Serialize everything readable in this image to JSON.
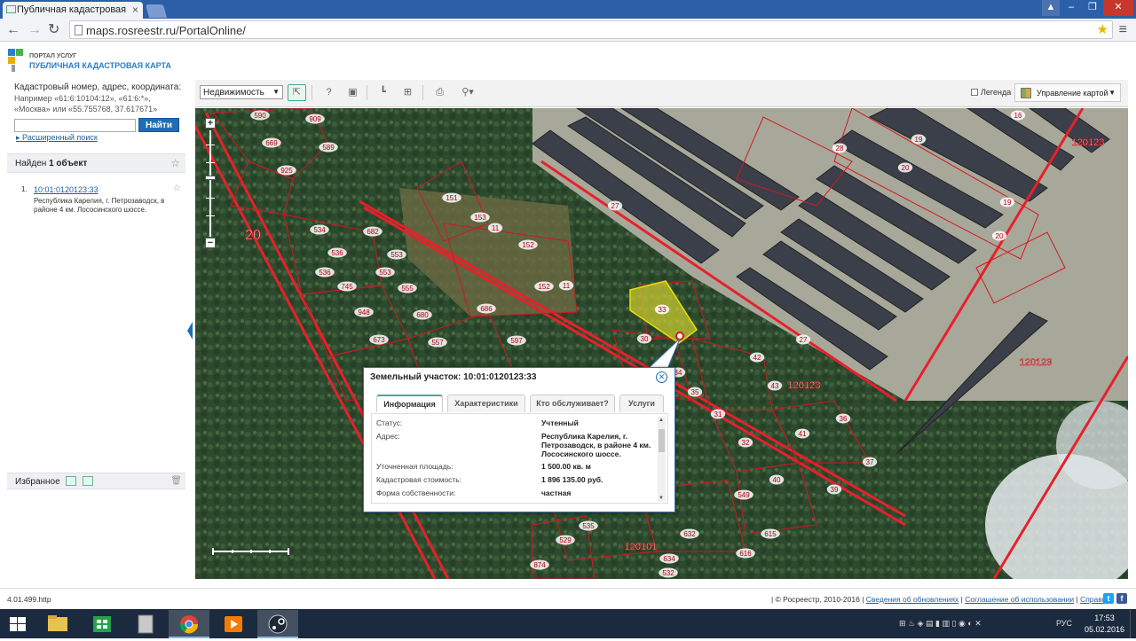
{
  "browser": {
    "tab_title": "Публичная кадастровая",
    "url": "maps.rosreestr.ru/PortalOnline/"
  },
  "portal": {
    "brand_small": "ПОРТАЛ УСЛУГ",
    "brand_title": "ПУБЛИЧНАЯ КАДАСТРОВАЯ КАРТА"
  },
  "search": {
    "help_title": "Кадастровый номер, адрес, координата:",
    "help_example": "Например «61:6:10104:12», «61:6:*», «Москва» или «55.755768, 37.617671»",
    "input_value": "",
    "button": "Найти",
    "advanced": "Расширенный поиск"
  },
  "results": {
    "found_prefix": "Найден ",
    "found_count": "1 объект",
    "item_number": "1.",
    "item_id": "10:01:0120123:33",
    "item_address": "Республика Карелия, г. Петрозаводск, в районе 4 км. Лососинского шоссе."
  },
  "favorites": {
    "label": "Избранное"
  },
  "toolbar": {
    "layer_select": "Недвижимость",
    "legend": "Легенда",
    "map_manage": "Управление картой"
  },
  "map": {
    "labels": [
      "590",
      "909",
      "669",
      "589",
      "925",
      "534",
      "682",
      "536",
      "553",
      "536",
      "553",
      "745",
      "555",
      "948",
      "680",
      "686",
      "673",
      "557",
      "597",
      "151",
      "153",
      "11",
      "152",
      "152",
      "11",
      "33",
      "30",
      "27",
      "16",
      "19",
      "20",
      "19",
      "20",
      "28",
      "120123",
      "120123",
      "120123",
      "27",
      "42",
      "43",
      "34",
      "35",
      "31",
      "32",
      "36",
      "41",
      "37",
      "40",
      "39",
      "549",
      "615",
      "616",
      "632",
      "634",
      "532",
      "535",
      "529",
      "874",
      "120101",
      "20"
    ]
  },
  "popup": {
    "title": "Земельный участок: 10:01:0120123:33",
    "tabs": [
      "Информация",
      "Характеристики",
      "Кто обслуживает?",
      "Услуги"
    ],
    "rows": [
      {
        "label": "Статус:",
        "value": "Учтенный"
      },
      {
        "label": "Адрес:",
        "value": "Республика Карелия, г. Петрозаводск, в районе 4 км. Лососинского шоссе."
      },
      {
        "label": "Уточненная площадь:",
        "value": "1 500.00 кв. м"
      },
      {
        "label": "Кадастровая стоимость:",
        "value": "1 896 135.00 руб."
      },
      {
        "label": "Форма собственности:",
        "value": "частная"
      }
    ]
  },
  "footer": {
    "version": "4.01.499.http",
    "copyright": "| © Росреестр, 2010-2016 |",
    "link_updates": "Сведения об обновлениях",
    "link_terms": "Соглашение об использовании",
    "link_help": "Справка"
  },
  "taskbar": {
    "lang": "РУС",
    "time": "17:53",
    "date": "05.02.2016"
  },
  "colors": {
    "accent": "#1f6db5",
    "parcel_line": "#e8202a",
    "selected_parcel": "#c8c830"
  }
}
